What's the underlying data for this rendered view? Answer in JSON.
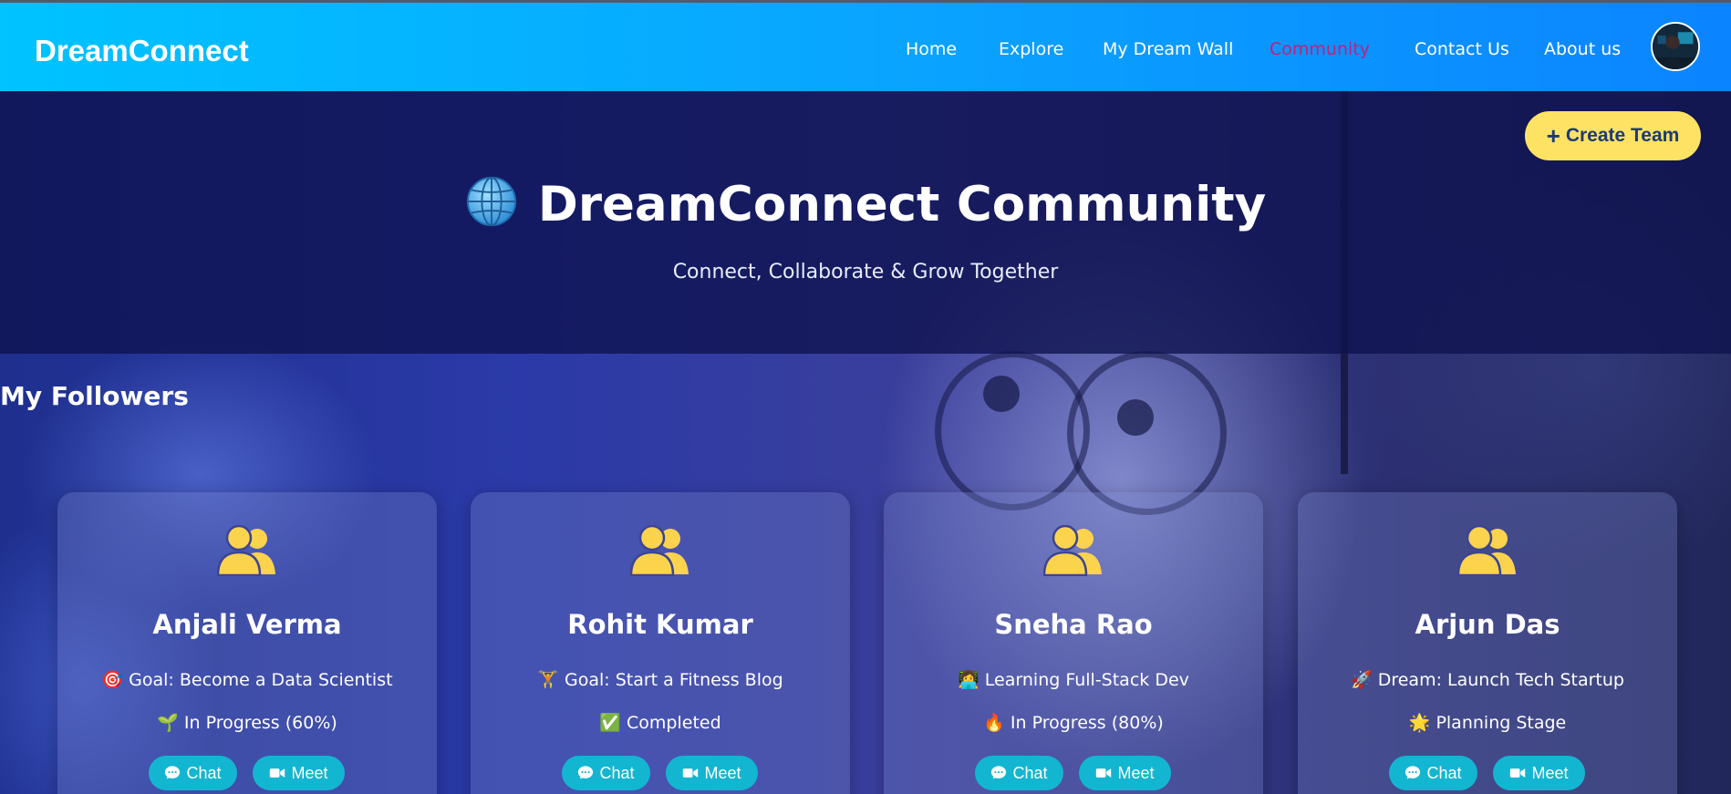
{
  "navbar": {
    "brand": "DreamConnect",
    "links": [
      {
        "label": "Home"
      },
      {
        "label": "Explore"
      },
      {
        "label": "My Dream Wall"
      },
      {
        "label": "Community",
        "active": true
      },
      {
        "label": "Contact Us"
      },
      {
        "label": "About us"
      }
    ]
  },
  "hero": {
    "title": "DreamConnect Community",
    "subtitle": "Connect, Collaborate & Grow Together",
    "create_team_label": "Create Team"
  },
  "followers": {
    "title": "My Followers",
    "cards": [
      {
        "name": "Anjali Verma",
        "goal": "🎯 Goal: Become a Data Scientist",
        "status": "🌱 In Progress (60%)",
        "chat_label": "Chat",
        "meet_label": "Meet"
      },
      {
        "name": "Rohit Kumar",
        "goal": "🏋️ Goal: Start a Fitness Blog",
        "status": "✅ Completed",
        "chat_label": "Chat",
        "meet_label": "Meet"
      },
      {
        "name": "Sneha Rao",
        "goal": "👩‍💻 Learning Full-Stack Dev",
        "status": "🔥 In Progress (80%)",
        "chat_label": "Chat",
        "meet_label": "Meet"
      },
      {
        "name": "Arjun Das",
        "goal": "🚀 Dream: Launch Tech Startup",
        "status": "🌟 Planning Stage",
        "chat_label": "Chat",
        "meet_label": "Meet"
      }
    ]
  },
  "colors": {
    "accent_yellow": "#fde264",
    "button_teal": "#13b6d1",
    "active_link": "#c2217a",
    "icon_yellow": "#fcd34d"
  }
}
